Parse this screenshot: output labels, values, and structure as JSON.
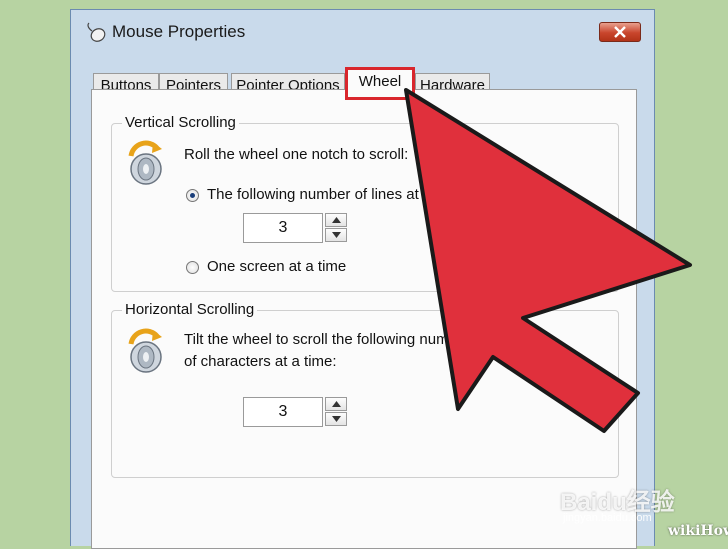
{
  "window": {
    "title": "Mouse Properties",
    "close_symbol": "×"
  },
  "tabs": [
    {
      "label": "Buttons",
      "active": false
    },
    {
      "label": "Pointers",
      "active": false
    },
    {
      "label": "Pointer Options",
      "active": false
    },
    {
      "label": "Wheel",
      "active": true
    },
    {
      "label": "Hardware",
      "active": false
    }
  ],
  "vertical_scrolling": {
    "group_label": "Vertical Scrolling",
    "instruction": "Roll the wheel one notch to scroll:",
    "option_lines_label": "The following number of lines at",
    "option_lines_selected": true,
    "lines_value": "3",
    "option_screen_label": "One screen at a time",
    "option_screen_selected": false
  },
  "horizontal_scrolling": {
    "group_label": "Horizontal Scrolling",
    "instruction_line1": "Tilt the wheel to scroll the following num",
    "instruction_line2": "of characters at a time:",
    "chars_value": "3"
  },
  "annotation": {
    "arrow_color": "#e0303c",
    "highlight_color": "#d9262c"
  },
  "watermarks": {
    "baidu": "Baidu经验",
    "baidu_url": "jingyan.baidu.com",
    "wikihow": "wikiHow"
  }
}
